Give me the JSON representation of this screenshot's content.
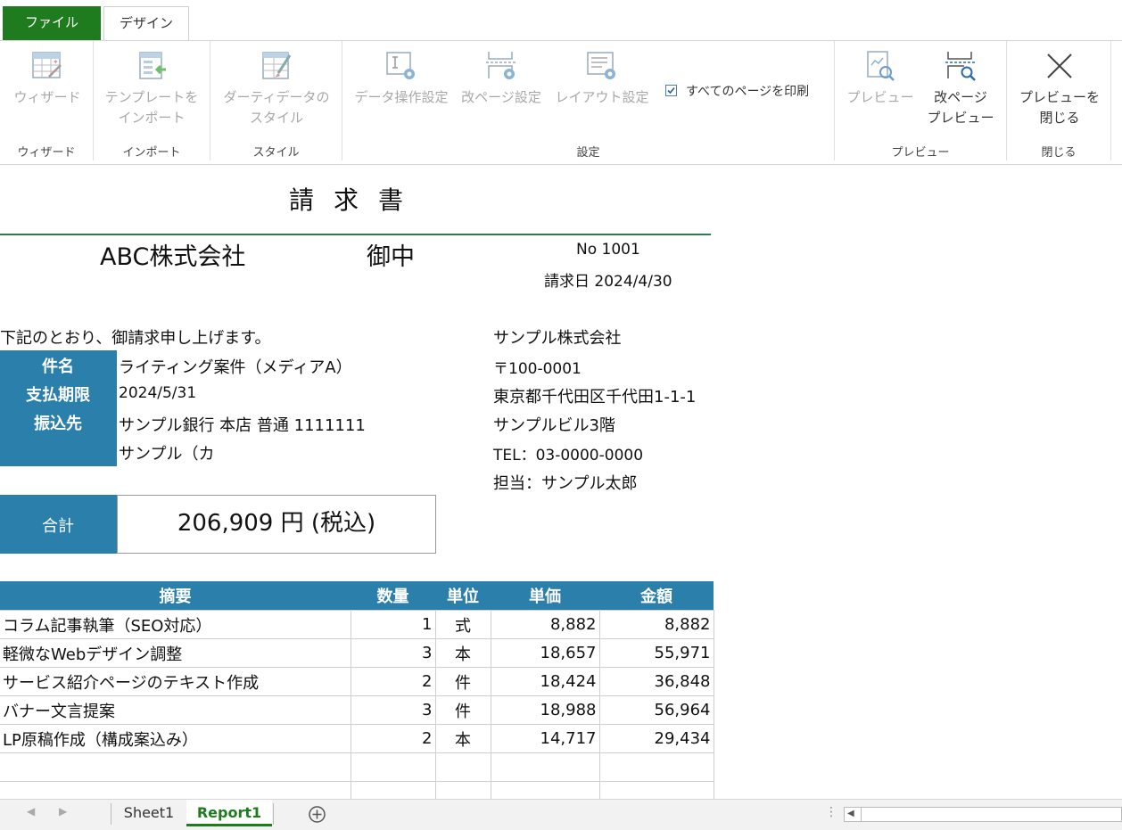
{
  "ribbon": {
    "tabs": [
      {
        "label": "ファイル"
      },
      {
        "label": "デザイン"
      }
    ],
    "buttons": {
      "wizard": "ウィザード",
      "import_l1": "テンプレートを",
      "import_l2": "インポート",
      "style_l1": "ダーティデータの",
      "style_l2": "スタイル",
      "data_op": "データ操作設定",
      "pagebreak": "改ページ設定",
      "layout": "レイアウト設定",
      "print_all": "すべてのページを印刷",
      "preview": "プレビュー",
      "pb_preview_l1": "改ページ",
      "pb_preview_l2": "プレビュー",
      "close_l1": "プレビューを",
      "close_l2": "閉じる"
    },
    "groups": {
      "wizard": "ウィザード",
      "import": "インポート",
      "style": "スタイル",
      "settings": "設定",
      "preview": "プレビュー",
      "close": "閉じる"
    }
  },
  "invoice": {
    "title": "請求書",
    "client": "ABC株式会社",
    "honorific": "御中",
    "number": "No 1001",
    "date": "請求日 2024/4/30",
    "intro": "下記のとおり、御請求申し上げます。",
    "labels": {
      "subject": "件名",
      "due": "支払期限",
      "bank": "振込先",
      "total": "合計"
    },
    "subject": "ライティング案件（メディアA）",
    "due": "2024/5/31",
    "bank_line1": "サンプル銀行 本店 普通 1111111",
    "bank_line2": "サンプル（カ",
    "total": "206,909 円 (税込)",
    "issuer": {
      "company": "サンプル株式会社",
      "zip": "〒100-0001",
      "address": "東京都千代田区千代田1-1-1",
      "building": "サンプルビル3階",
      "tel": "TEL：03-0000-0000",
      "contact": "担当：サンプル太郎"
    },
    "table": {
      "headers": [
        "摘要",
        "数量",
        "単位",
        "単価",
        "金額"
      ],
      "rows": [
        [
          "コラム記事執筆（SEO対応）",
          "1",
          "式",
          "8,882",
          "8,882"
        ],
        [
          "軽微なWebデザイン調整",
          "3",
          "本",
          "18,657",
          "55,971"
        ],
        [
          "サービス紹介ページのテキスト作成",
          "2",
          "件",
          "18,424",
          "36,848"
        ],
        [
          "バナー文言提案",
          "3",
          "件",
          "18,988",
          "56,964"
        ],
        [
          "LP原稿作成（構成案込み）",
          "2",
          "本",
          "14,717",
          "29,434"
        ]
      ]
    }
  },
  "sheets": [
    {
      "label": "Sheet1"
    },
    {
      "label": "Report1"
    }
  ],
  "colors": {
    "accent_green": "#1e7b1e",
    "table_blue": "#2a7fab"
  }
}
